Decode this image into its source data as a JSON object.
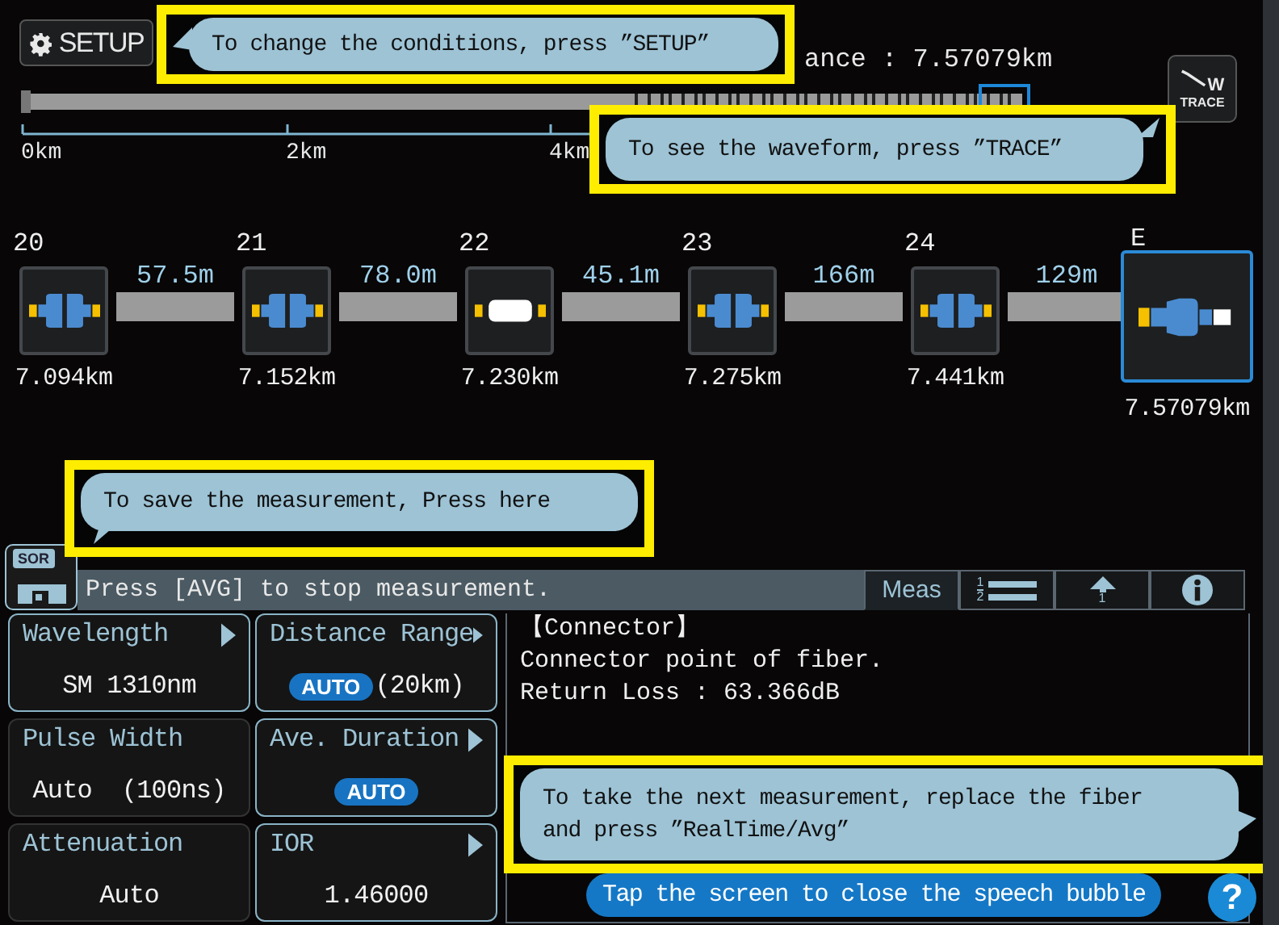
{
  "setup_button": "SETUP",
  "distance_label": "ance : 7.57079km",
  "trace_button": {
    "letter": "W",
    "label": "TRACE"
  },
  "scale_ticks": [
    "0km",
    "2km",
    "4km"
  ],
  "events": [
    {
      "number": "20",
      "kind": "connector",
      "position": "7.094km",
      "selected": false
    },
    {
      "number": "21",
      "kind": "connector",
      "position": "7.152km",
      "selected": false
    },
    {
      "number": "22",
      "kind": "splice",
      "position": "7.230km",
      "selected": false
    },
    {
      "number": "23",
      "kind": "connector",
      "position": "7.275km",
      "selected": false
    },
    {
      "number": "24",
      "kind": "connector",
      "position": "7.441km",
      "selected": false
    },
    {
      "number": "E",
      "kind": "end",
      "position": "7.57079km",
      "selected": true
    }
  ],
  "spans": [
    "57.5m",
    "78.0m",
    "45.1m",
    "166m",
    "129m"
  ],
  "save_icon_text": "SOR",
  "status_message": "Press [AVG] to stop measurement.",
  "tabs": [
    {
      "kind": "text",
      "label": "Meas",
      "selected": true
    },
    {
      "kind": "list",
      "digits": [
        "1",
        "2"
      ],
      "selected": false
    },
    {
      "kind": "up",
      "label": "1",
      "selected": false
    },
    {
      "kind": "info",
      "selected": false
    }
  ],
  "settings": [
    {
      "label": "Wavelength",
      "value": "SM 1310nm",
      "has_arrow": true
    },
    {
      "label": "Distance Range",
      "badge": "AUTO",
      "value": "(20km)",
      "has_arrow": true
    },
    {
      "label": "Pulse Width",
      "value": "Auto  (100ns)",
      "has_arrow": false
    },
    {
      "label": "Ave. Duration",
      "badge": "AUTO",
      "has_arrow": true
    },
    {
      "label": "Attenuation",
      "value": "Auto",
      "has_arrow": false
    },
    {
      "label": "IOR",
      "value": "1.46000",
      "has_arrow": true
    }
  ],
  "detail_lines": [
    "【Connector】",
    "Connector point of fiber.",
    "Return Loss : 63.366dB"
  ],
  "callouts": [
    {
      "text": "To change the conditions, press ”SETUP”",
      "kind": "left"
    },
    {
      "text": "To see the waveform, press ”TRACE”",
      "kind": "upright"
    },
    {
      "text": "To save the measurement, Press here",
      "kind": "downleft"
    },
    {
      "text": "To take the next measurement, replace the fiber and press ”RealTime/Avg”",
      "kind": "right"
    }
  ],
  "close_hint": "Tap the screen to close the speech bubble",
  "help_button": "?"
}
